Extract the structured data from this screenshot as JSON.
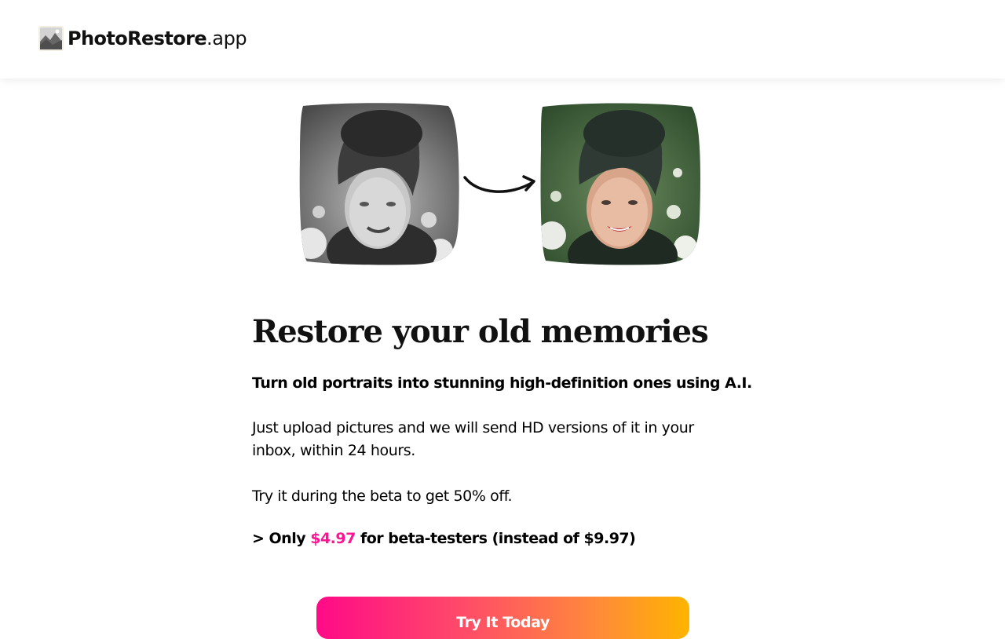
{
  "header": {
    "logo_strong": "PhotoRestore",
    "logo_light": ".app"
  },
  "hero": {
    "images": [
      {
        "name": "before-portrait",
        "kind": "black-and-white old photo"
      },
      {
        "name": "after-portrait",
        "kind": "restored color photo"
      }
    ],
    "arrow_icon": "curved-arrow-right-icon"
  },
  "content": {
    "headline": "Restore your old memories",
    "subhead": "Turn old portraits into stunning high-definition ones using A.I.",
    "body": "Just upload pictures and we will send HD versions of it in your inbox, within 24 hours.",
    "beta": "Try it during the beta to get 50% off.",
    "price_prefix": "> Only ",
    "price": "$4.97",
    "price_suffix": " for beta-testers (instead of $9.97)"
  },
  "cta": {
    "label": "Try It Today"
  },
  "colors": {
    "accent_pink": "#ff1493",
    "gradient_start": "#ff0a87",
    "gradient_end": "#ffb400"
  }
}
